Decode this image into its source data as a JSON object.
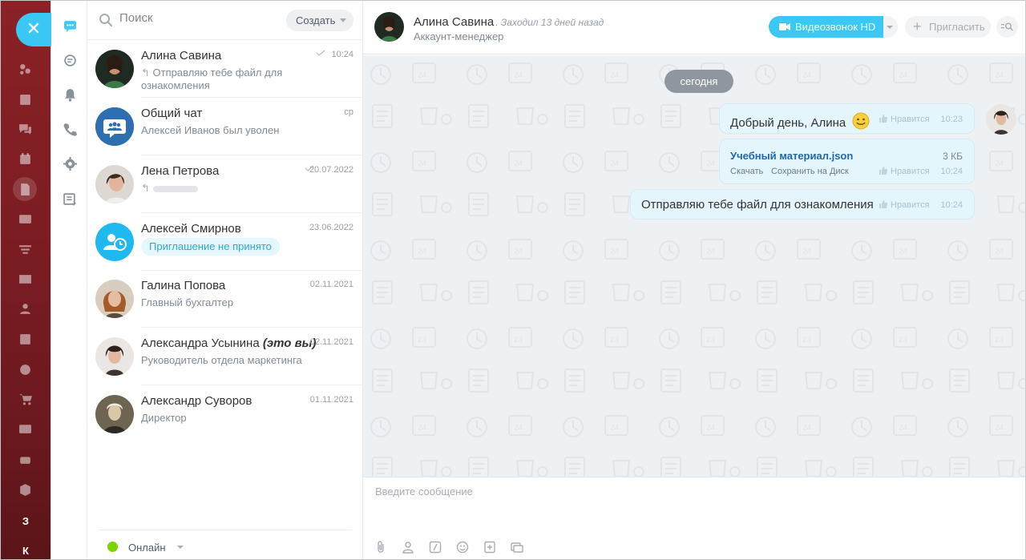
{
  "app": {
    "online_status": "Онлайн"
  },
  "search": {
    "placeholder": "Поиск",
    "create_label": "Создать"
  },
  "rail": {
    "bottom_letters": [
      "З",
      "К"
    ]
  },
  "recents": [
    {
      "name": "Алина Савина",
      "subtitle": "Отправляю тебе файл для ознакомления",
      "date": "10:24",
      "read": true,
      "reply_icon": true
    },
    {
      "name": "Общий чат",
      "subtitle": "Алексей Иванов был уволен",
      "date": "ср"
    },
    {
      "name": "Лена Петрова",
      "subtitle": "",
      "date": "20.07.2022",
      "read": true
    },
    {
      "name": "Алексей Смирнов",
      "badge": "Приглашение не принято",
      "date": "23.06.2022"
    },
    {
      "name": "Галина Попова",
      "subtitle": "Главный бухгалтер",
      "date": "02.11.2021"
    },
    {
      "name": "Александра Усынина",
      "name_suffix": "(это вы)",
      "subtitle": "Руководитель отдела маркетинга",
      "date": "02.11.2021"
    },
    {
      "name": "Александр Суворов",
      "subtitle": "Директор",
      "date": "01.11.2021"
    }
  ],
  "chat": {
    "name": "Алина Савина",
    "last_seen": ". Заходил 13 дней назад",
    "position": "Аккаунт-менеджер",
    "video_label": "Видеозвонок HD",
    "invite_label": "Пригласить",
    "date_divider": "сегодня",
    "like_label": "Нравится",
    "messages": [
      {
        "text": "Добрый день, Алина",
        "emoji": "smile",
        "time": "10:23"
      },
      {
        "file_name": "Учебный материал.json",
        "file_size": "3 КБ",
        "download": "Скачать",
        "save_disk": "Сохранить на Диск",
        "time": "10:24"
      },
      {
        "text": "Отправляю тебе файл для ознакомления",
        "time": "10:24"
      }
    ],
    "input_placeholder": "Введите сообщение"
  },
  "colors": {
    "accent": "#3bc8f5",
    "rail": "#7c1d23",
    "online": "#7bd500",
    "chat_bg": "#edf1f4",
    "bubble": "#e5f5fc"
  }
}
